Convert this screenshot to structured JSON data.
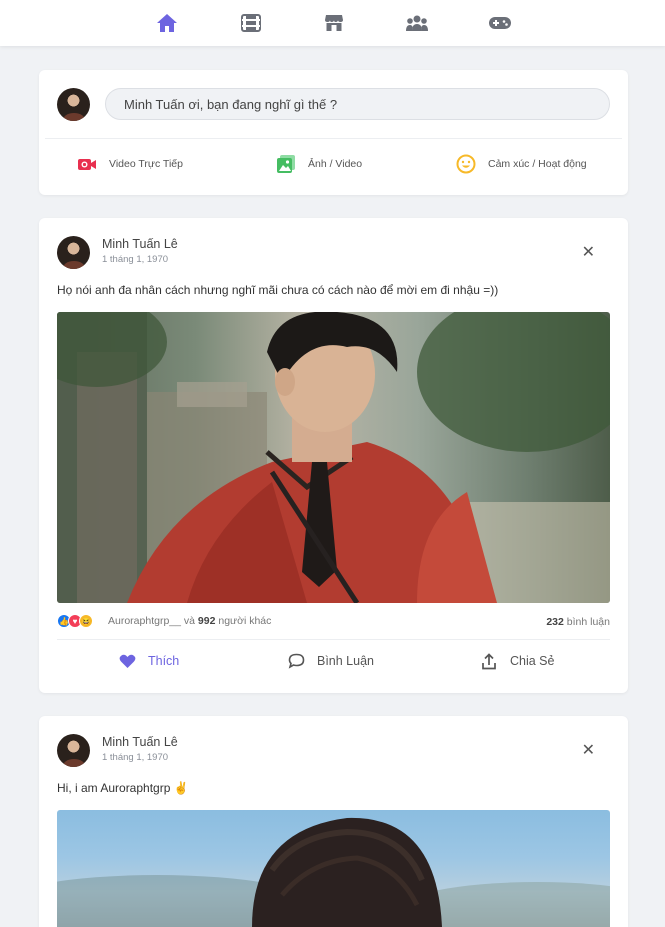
{
  "nav": {
    "icons": [
      "home-icon",
      "video-icon",
      "store-icon",
      "groups-icon",
      "gaming-icon"
    ],
    "active_color": "#6d64e0",
    "inactive_color": "#6b6f78"
  },
  "composer": {
    "placeholder": "Minh Tuấn ơi, bạn đang nghĩ gì thế ?",
    "actions": [
      {
        "label": "Video Trực Tiếp",
        "icon": "live-video-icon",
        "color": "#e8304f"
      },
      {
        "label": "Ảnh / Video",
        "icon": "photo-icon",
        "color": "#45bd62"
      },
      {
        "label": "Cảm xúc / Hoạt động",
        "icon": "smiley-icon",
        "color": "#f7b928"
      }
    ]
  },
  "posts": [
    {
      "author": "Minh Tuấn Lê",
      "date": "1 tháng 1, 1970",
      "caption": "Họ nói anh đa nhân cách nhưng nghĩ mãi chưa có cách nào để mời em đi nhậu =))",
      "reactor": "Auroraphtgrp__",
      "reactor_joiner": "và",
      "reaction_count": "992",
      "reaction_suffix": "người khác",
      "comment_count": "232",
      "comment_label": "bình luận",
      "buttons": {
        "like": "Thích",
        "comment": "Bình Luận",
        "share": "Chia Sẻ"
      }
    },
    {
      "author": "Minh Tuấn Lê",
      "date": "1 tháng 1, 1970",
      "caption": "Hi, i am Auroraphtgrp ✌️"
    }
  ]
}
